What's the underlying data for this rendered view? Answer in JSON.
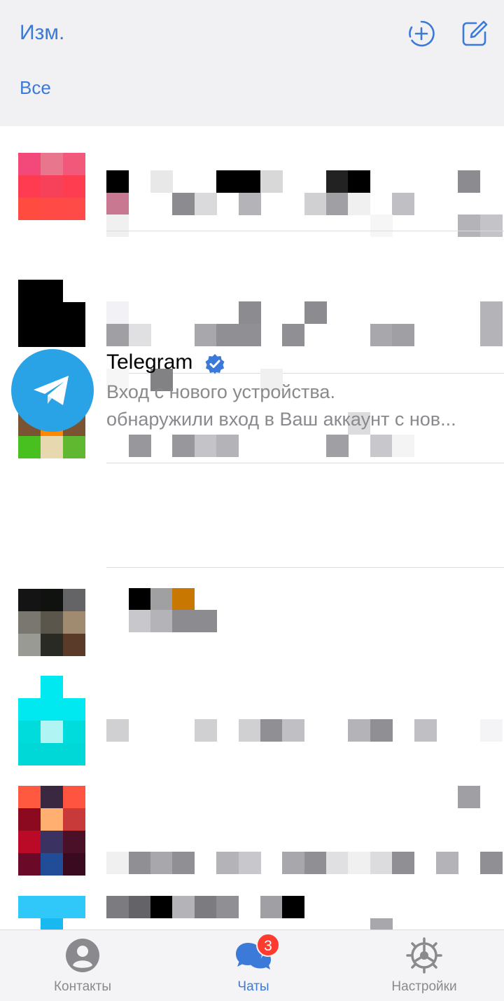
{
  "header": {
    "edit_label": "Изм.",
    "filter_tab": "Все",
    "icons": [
      "new-story-icon",
      "compose-icon"
    ]
  },
  "chats": {
    "telegram": {
      "name": "Telegram",
      "verified": true,
      "preview_line1": "Вход с нового устройства.",
      "preview_line2": "обнаружили вход в Ваш аккаунт с нов..."
    }
  },
  "tabbar": {
    "contacts_label": "Контакты",
    "chats_label": "Чаты",
    "chats_badge": "3",
    "settings_label": "Настройки"
  },
  "colors": {
    "accent": "#3c7ad9",
    "telegram_blue": "#2aa3e6",
    "badge": "#ff3b30",
    "secondary_text": "#8a8a8e"
  }
}
